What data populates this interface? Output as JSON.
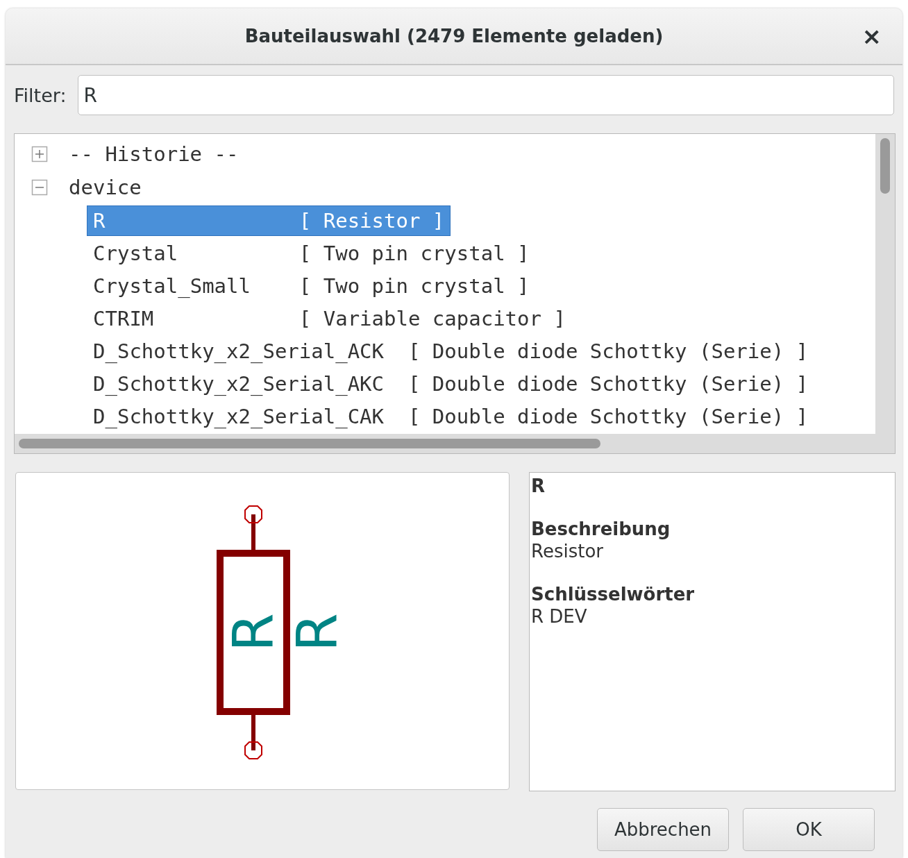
{
  "window": {
    "title": "Bauteilauswahl (2479 Elemente geladen)",
    "close": "×"
  },
  "filter": {
    "label": "Filter:",
    "value": "R"
  },
  "tree": [
    {
      "label": "-- Historie --",
      "expanded": false
    },
    {
      "label": "device",
      "expanded": true,
      "children": [
        {
          "name": "R",
          "description": "[ Resistor ]",
          "selected": true
        },
        {
          "name": "Crystal",
          "description": "[ Two pin crystal ]",
          "selected": false
        },
        {
          "name": "Crystal_Small",
          "description": "[ Two pin crystal ]",
          "selected": false
        },
        {
          "name": "CTRIM",
          "description": "[ Variable capacitor ]",
          "selected": false
        },
        {
          "name": "D_Schottky_x2_Serial_ACK",
          "description": "[ Double diode Schottky (Serie) ]",
          "selected": false
        },
        {
          "name": "D_Schottky_x2_Serial_AKC",
          "description": "[ Double diode Schottky (Serie) ]",
          "selected": false
        },
        {
          "name": "D_Schottky_x2_Serial_CAK",
          "description": "[ Double diode Schottky (Serie) ]",
          "selected": false
        }
      ]
    }
  ],
  "preview": {
    "reference": "R",
    "value": "R"
  },
  "info": {
    "name": "R",
    "sections": [
      {
        "heading": "Beschreibung",
        "text": "Resistor"
      },
      {
        "heading": "Schlüsselwörter",
        "text": "R DEV"
      }
    ]
  },
  "buttons": [
    {
      "label": "Abbrechen"
    },
    {
      "label": "OK"
    }
  ]
}
